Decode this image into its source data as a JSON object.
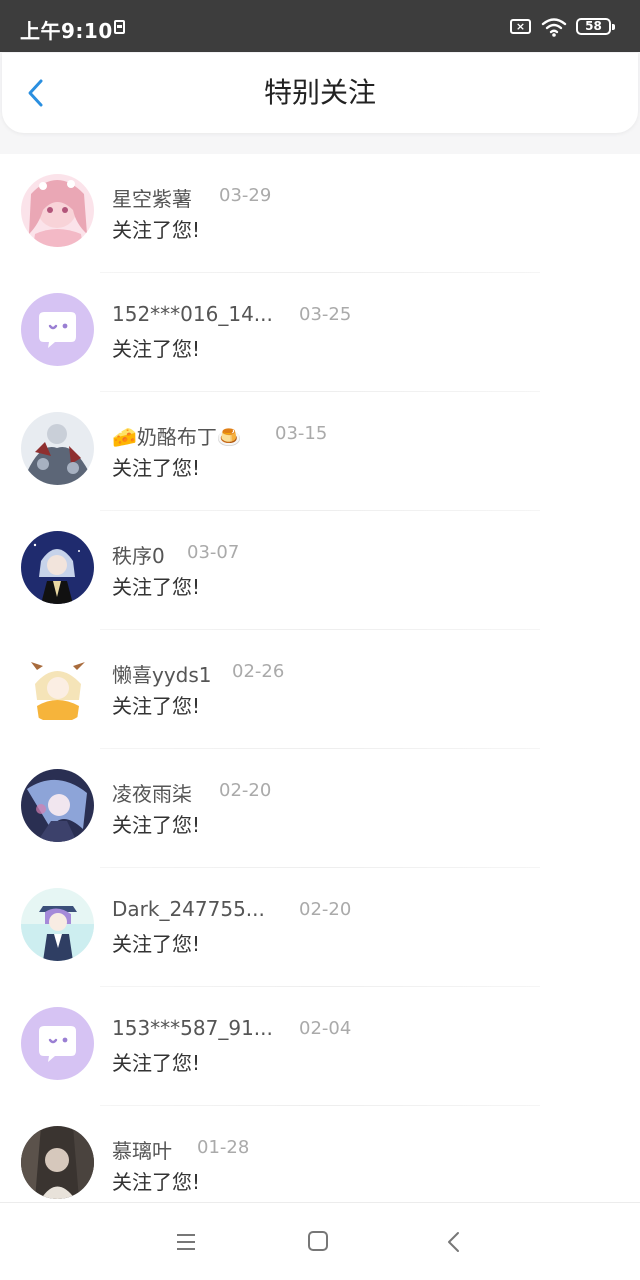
{
  "status": {
    "time": "上午9:10",
    "sim": "×",
    "battery": "58"
  },
  "header": {
    "title": "特别关注"
  },
  "items": [
    {
      "name": "星空紫薯",
      "date": "03-29",
      "message": "关注了您!",
      "avatar": "anime-girl-pink"
    },
    {
      "name": "152***016_14...",
      "date": "03-25",
      "message": "关注了您!",
      "avatar": "default-purple"
    },
    {
      "name": "🧀奶酪布丁🍮",
      "date": "03-15",
      "message": "关注了您!",
      "avatar": "anime-group-armor"
    },
    {
      "name": "秩序0",
      "date": "03-07",
      "message": "关注了您!",
      "avatar": "anime-night-boy"
    },
    {
      "name": "懒喜yyds1",
      "date": "02-26",
      "message": "关注了您!",
      "avatar": "anime-blonde-horns"
    },
    {
      "name": "凌夜雨柒",
      "date": "02-20",
      "message": "关注了您!",
      "avatar": "anime-blue-girl"
    },
    {
      "name": "Dark_247755...",
      "date": "02-20",
      "message": "关注了您!",
      "avatar": "anime-hat-boy"
    },
    {
      "name": "153***587_91...",
      "date": "02-04",
      "message": "关注了您!",
      "avatar": "default-purple"
    },
    {
      "name": "慕璃叶",
      "date": "01-28",
      "message": "关注了您!",
      "avatar": "dark-photo"
    }
  ],
  "colors": {
    "accent": "#2a8fe0",
    "default_avatar": "#d6c3f3"
  }
}
